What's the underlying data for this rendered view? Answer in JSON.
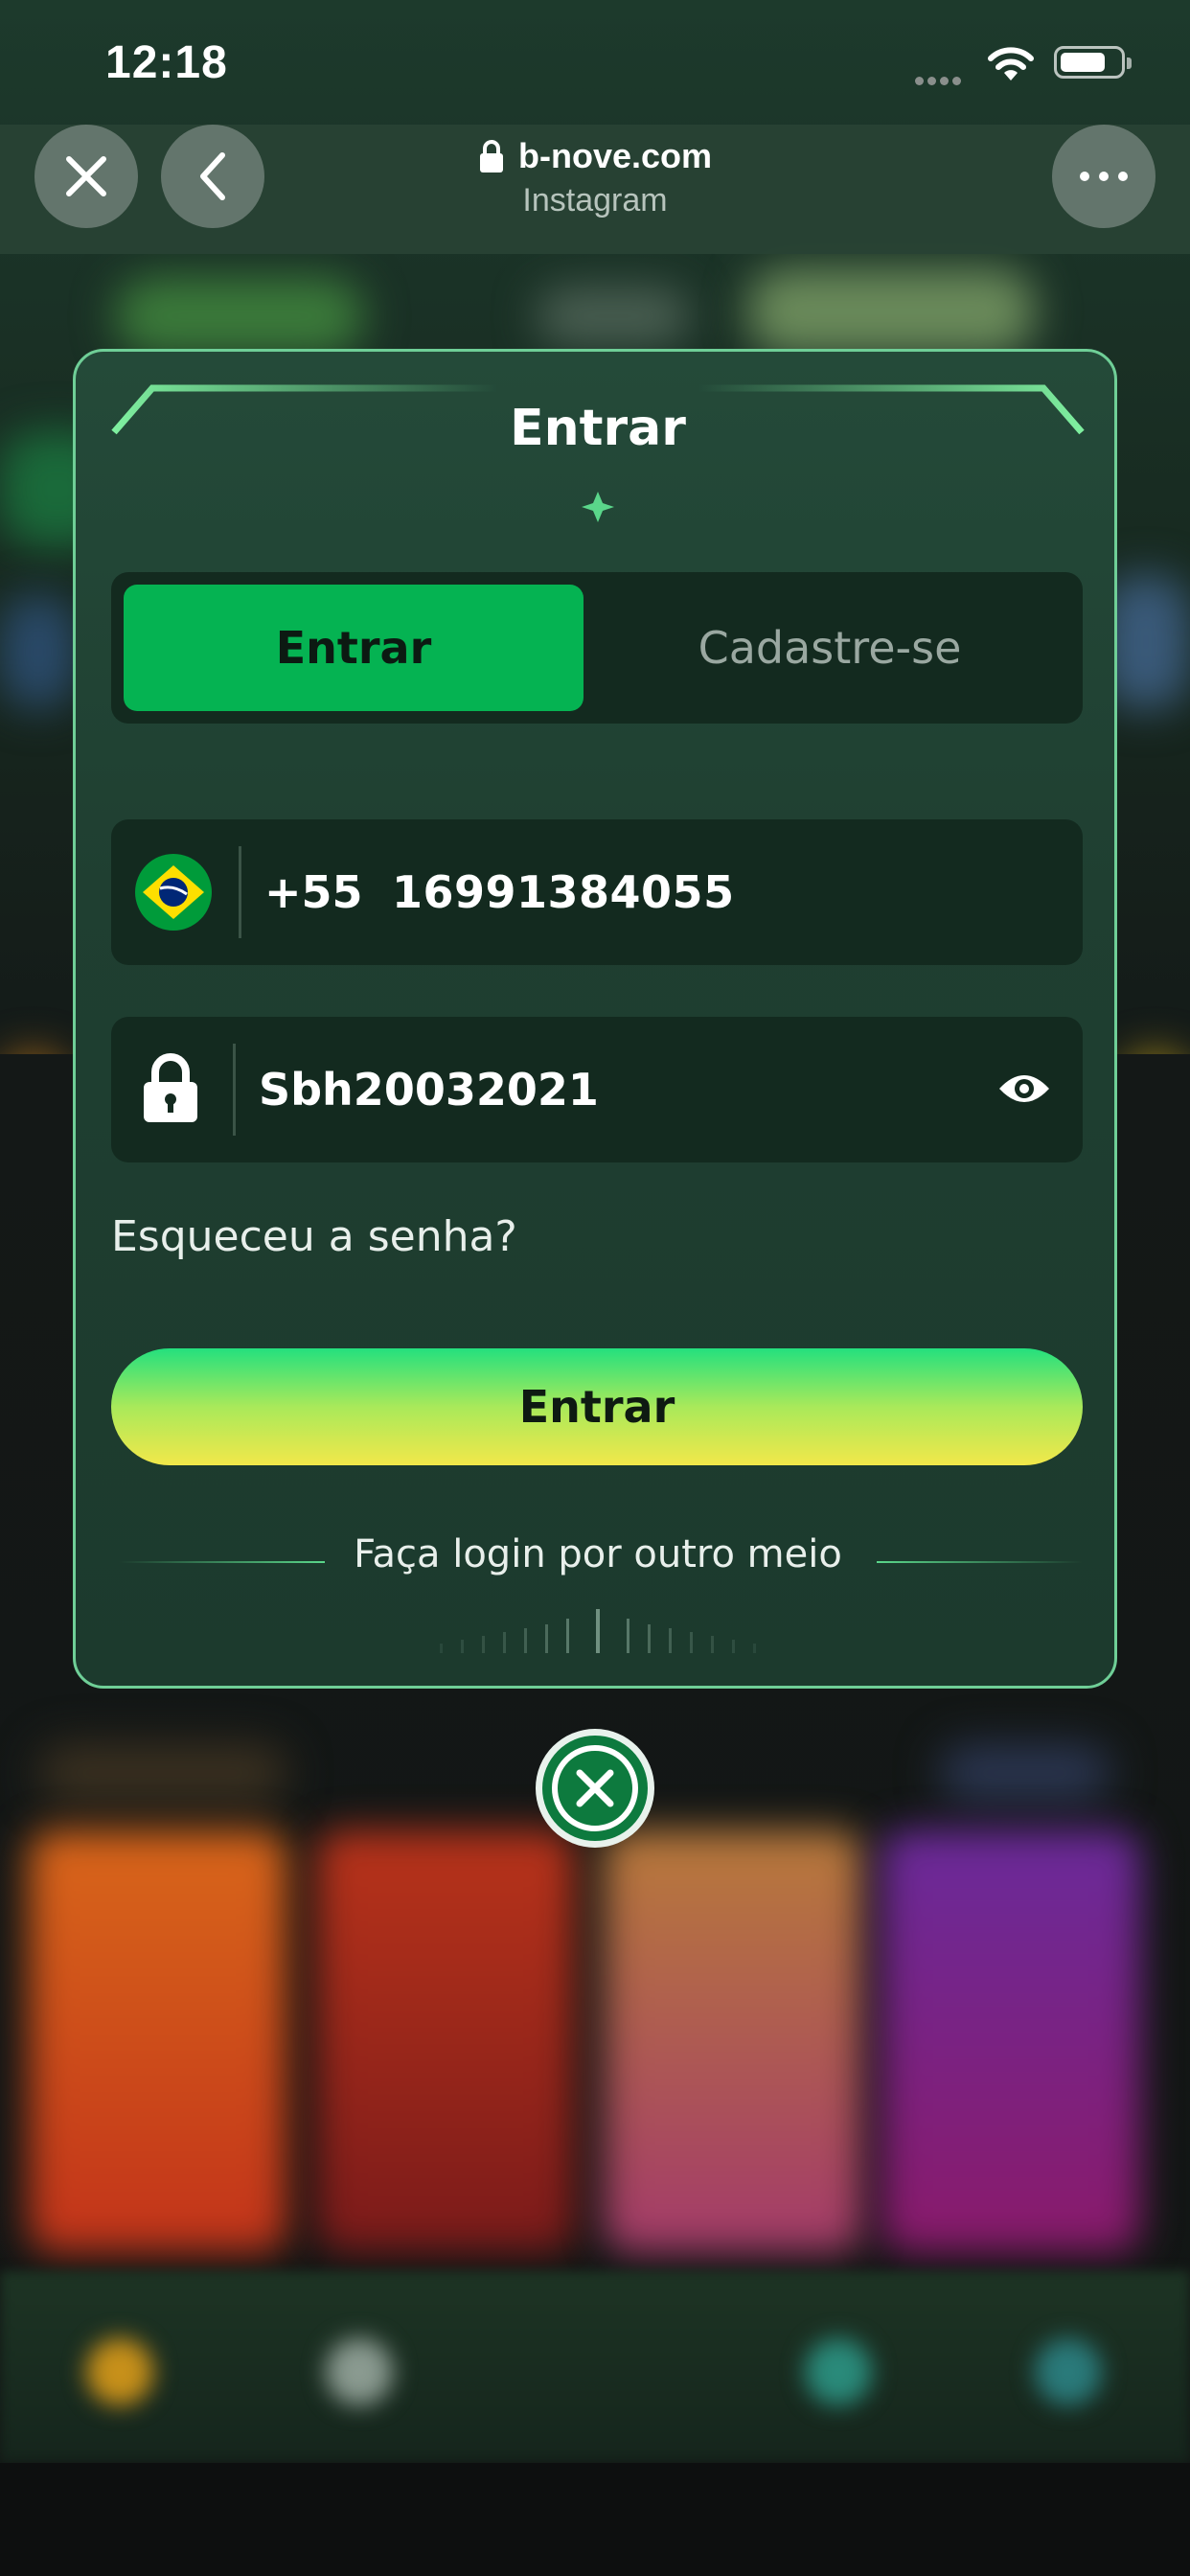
{
  "status_bar": {
    "time": "12:18"
  },
  "browser": {
    "url": "b-nove.com",
    "source": "Instagram"
  },
  "modal": {
    "title": "Entrar",
    "tabs": [
      {
        "label": "Entrar",
        "active": true
      },
      {
        "label": "Cadastre-se",
        "active": false
      }
    ],
    "phone": {
      "country_code": "+55",
      "value": "16991384055",
      "flag": "brazil-flag-icon"
    },
    "password": {
      "value": "Sbh20032021"
    },
    "forgot_label": "Esqueceu a senha?",
    "submit_label": "Entrar",
    "other_login_label": "Faça login por outro meio"
  },
  "colors": {
    "accent_green": "#05b352",
    "modal_border": "#6fcf97",
    "submit_gradient_top": "#24e07e",
    "submit_gradient_bottom": "#f2e84a"
  }
}
